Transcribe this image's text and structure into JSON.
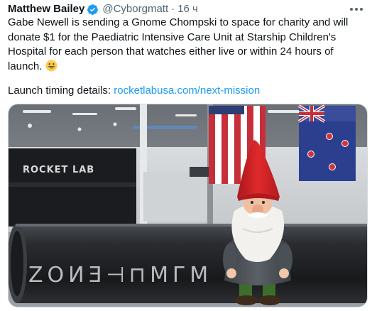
{
  "author": {
    "name": "Matthew Bailey",
    "handle": "@Cyborgmatt",
    "separator": "·",
    "time": "16 ч"
  },
  "icons": {
    "verified": "verified-badge-icon",
    "more": "more-options-icon",
    "emoji": "grinning-face-emoji"
  },
  "tweet": {
    "body": "Gabe Newell is sending a Gnome Chompski to space for charity and will donate $1 for the Paediatric Intensive Care Unit at Starship Children's Hospital for each person that watches either live or within 24 hours of launch.",
    "timing_label": "Launch timing details: ",
    "timing_link": "rocketlabusa.com/next-mission"
  },
  "media": {
    "wall_sign": "ROCKET LAB",
    "rocket_text": "ZOИƎ⊣⊓MГM",
    "flag_flags": [
      "USA",
      "New Zealand"
    ]
  },
  "colors": {
    "link": "#1d9bf0",
    "verified": "#1d9bf0",
    "secondary_text": "#536471"
  }
}
